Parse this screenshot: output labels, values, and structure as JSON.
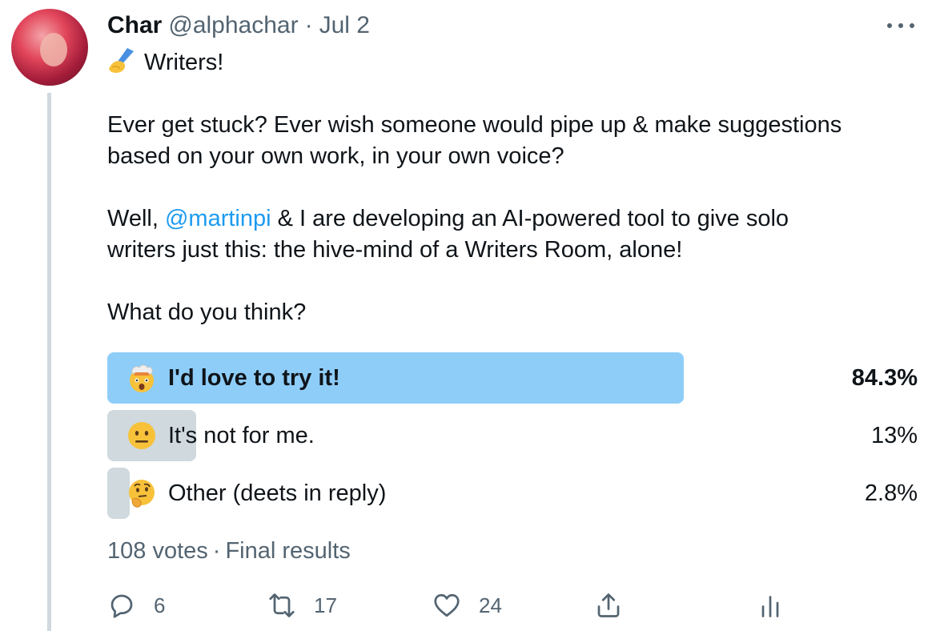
{
  "tweet": {
    "author": {
      "name": "Char",
      "handle": "@alphachar",
      "date": "Jul 2"
    },
    "header_separator": "·",
    "body": {
      "line1": "Writers!",
      "line2": "Ever get stuck? Ever wish someone would pipe up & make suggestions",
      "line3": "based on your own work, in your own voice?",
      "line4_prefix": "Well, ",
      "line4_mention": "@martinpi",
      "line4_suffix": " & I are developing an AI-powered tool to give solo",
      "line5": "writers just this: the hive-mind of a Writers Room, alone!",
      "line6": "What do you think?"
    },
    "poll": {
      "options": [
        {
          "label": "I'd love to try it!",
          "percent": "84.3%",
          "fraction": 0.843,
          "emoji": "exploding-head-emoji",
          "winner": true
        },
        {
          "label": "It's not for me.",
          "percent": "13%",
          "fraction": 0.13,
          "emoji": "neutral-face-emoji",
          "winner": false
        },
        {
          "label": "Other (deets in reply)",
          "percent": "2.8%",
          "fraction": 0.028,
          "emoji": "thinking-face-emoji",
          "winner": false
        }
      ],
      "votes": "108 votes",
      "separator": "·",
      "status": "Final results",
      "colors": {
        "winner_bar": "#8ecdf8",
        "other_bar": "#cfd9de"
      }
    },
    "actions": {
      "reply_count": "6",
      "retweet_count": "17",
      "like_count": "24"
    }
  },
  "icons": {
    "more": "more-dots-icon",
    "reply": "reply-icon",
    "retweet": "retweet-icon",
    "like": "like-icon",
    "share": "share-icon",
    "analytics": "analytics-icon"
  }
}
